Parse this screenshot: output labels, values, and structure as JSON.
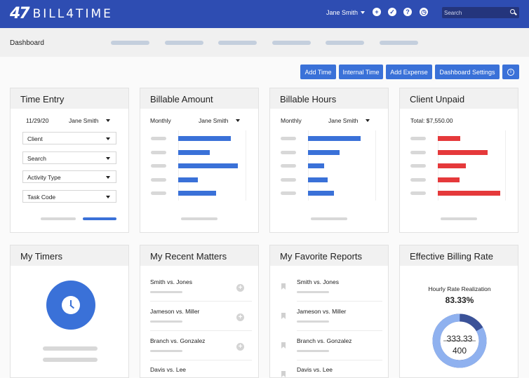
{
  "app": {
    "logo_mark": "47",
    "logo_text": "BILL4TIME"
  },
  "header": {
    "user": "Jane Smith",
    "icons": [
      "plus-circle-icon",
      "check-circle-icon",
      "help-icon",
      "clock-icon"
    ],
    "search_placeholder": "Search"
  },
  "breadcrumb": "Dashboard",
  "actions": {
    "add_time": "Add Time",
    "internal_time": "Internal Time",
    "add_expense": "Add Expense",
    "dashboard_settings": "Dashboard Settings",
    "info_icon": "info-icon"
  },
  "colors": {
    "primary": "#3a71d8",
    "header": "#2e4db2",
    "unpaid": "#e5393b"
  },
  "time_entry": {
    "title": "Time Entry",
    "date": "11/29/20",
    "user": "Jane Smith",
    "fields": [
      "Client",
      "Search",
      "Activity Type",
      "Task Code"
    ]
  },
  "billable_amount": {
    "title": "Billable Amount",
    "period": "Monthly",
    "user": "Jane Smith",
    "bars": [
      0.78,
      0.47,
      0.89,
      0.29,
      0.56
    ]
  },
  "billable_hours": {
    "title": "Billable Hours",
    "period": "Monthly",
    "user": "Jane Smith",
    "bars": [
      0.78,
      0.47,
      0.24,
      0.29,
      0.39
    ]
  },
  "client_unpaid": {
    "title": "Client Unpaid",
    "total": "Total: $7,550.00",
    "bars": [
      0.33,
      0.74,
      0.42,
      0.32,
      0.93
    ]
  },
  "my_timers": {
    "title": "My Timers"
  },
  "recent_matters": {
    "title": "My Recent Matters",
    "items": [
      "Smith vs. Jones",
      "Jameson vs. Miller",
      "Branch vs. Gonzalez",
      "Davis vs. Lee"
    ]
  },
  "favorite_reports": {
    "title": "My Favorite Reports",
    "items": [
      "Smith vs. Jones",
      "Jameson vs. Miller",
      "Branch vs. Gonzalez",
      "Davis vs. Lee"
    ]
  },
  "billing_rate": {
    "title": "Effective Billing Rate",
    "label": "Hourly Rate Realization",
    "percent": "83.33%",
    "numerator": "333.33",
    "denominator": "400",
    "realization": 0.8333
  }
}
